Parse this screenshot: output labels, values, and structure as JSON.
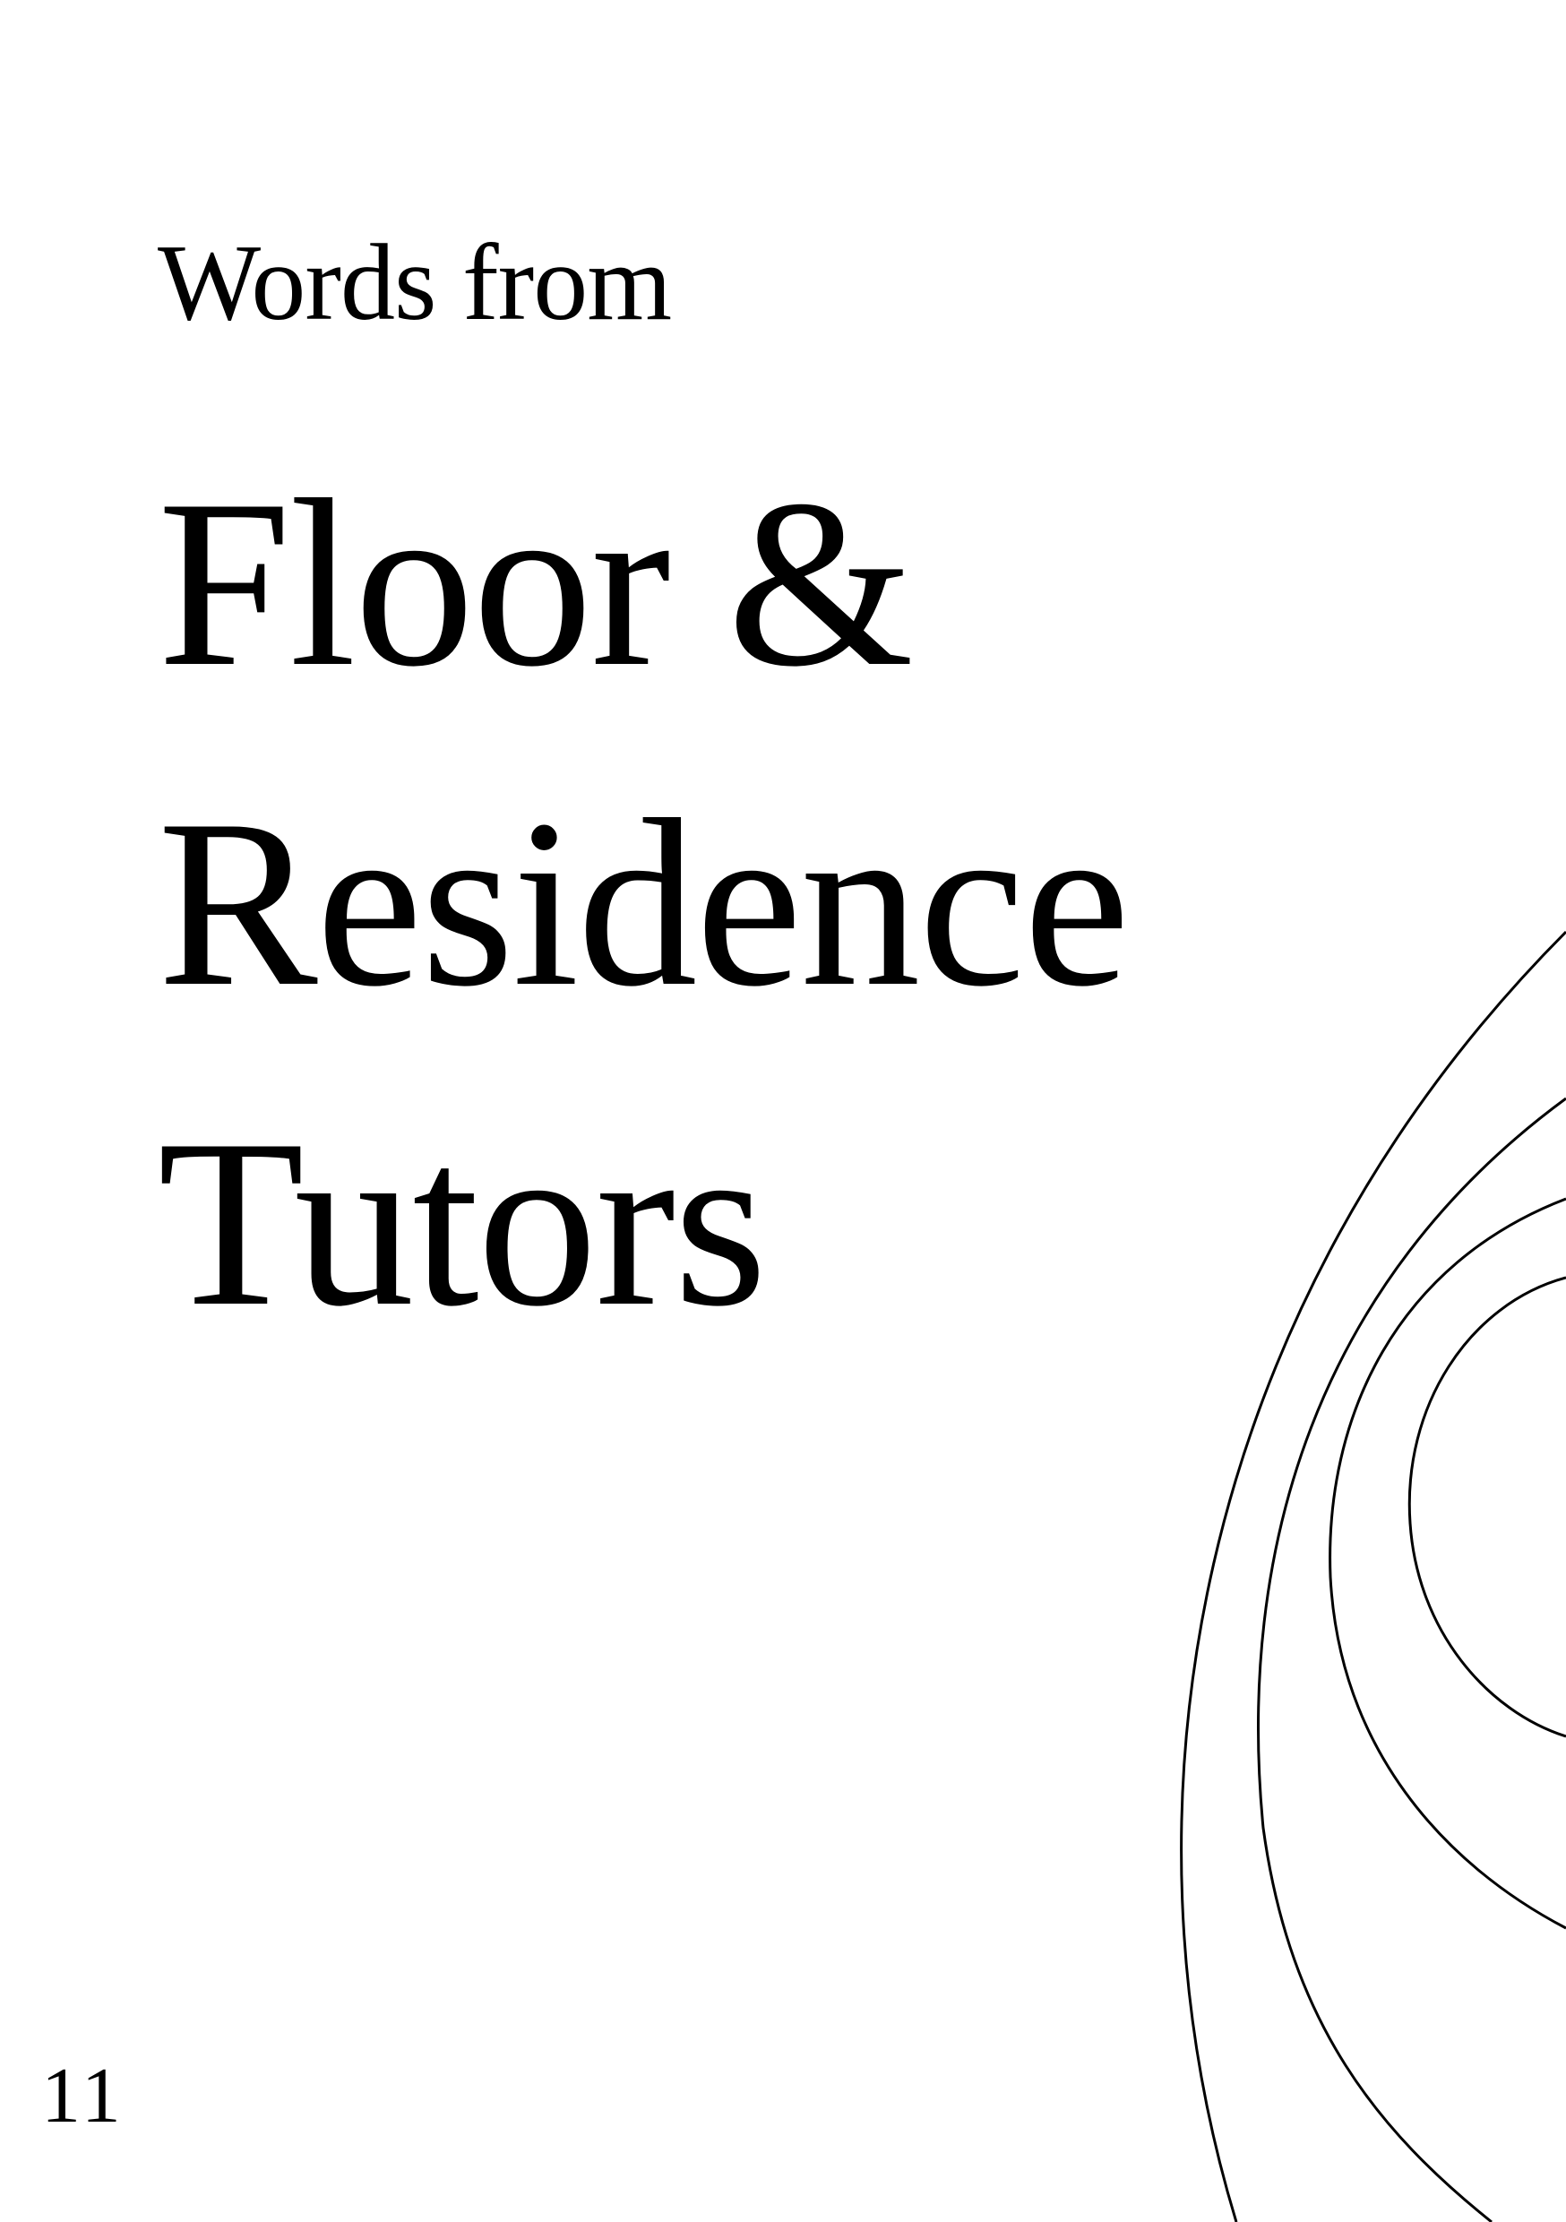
{
  "heading": {
    "subtitle": "Words from",
    "title_lines": [
      "Floor &",
      "Residence",
      "Tutors"
    ]
  },
  "page_number": "11",
  "decoration": {
    "name": "concentric-arcs",
    "stroke_color": "#000000"
  }
}
